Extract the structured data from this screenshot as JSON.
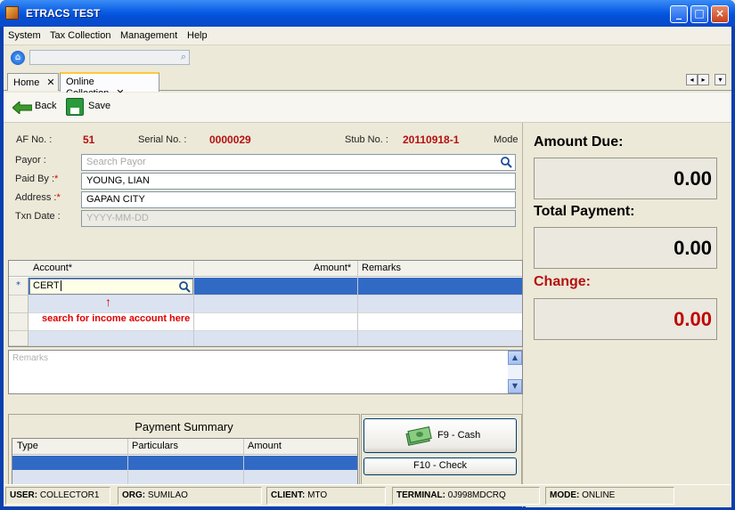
{
  "window": {
    "title": "ETRACS TEST"
  },
  "menu": {
    "items": [
      "System",
      "Tax Collection",
      "Management",
      "Help"
    ]
  },
  "tabs": [
    {
      "label": "Home"
    },
    {
      "label": "Online Collection"
    }
  ],
  "toolbar": {
    "back_label": "Back",
    "save_label": "Save"
  },
  "header": {
    "af_label": "AF No. :",
    "af_value": "51",
    "serial_label": "Serial No. :",
    "serial_value": "0000029",
    "stub_label": "Stub No. :",
    "stub_value": "20110918-1",
    "mode_label": "Mode"
  },
  "form": {
    "payor_label": "Payor :",
    "payor_placeholder": "Search Payor",
    "paidby_label": "Paid By :",
    "paidby_value": "YOUNG, LIAN",
    "address_label": "Address :",
    "address_value": "GAPAN CITY",
    "txndate_label": "Txn Date :",
    "txndate_placeholder": "YYYY-MM-DD"
  },
  "items_grid": {
    "columns": [
      "Account*",
      "Amount*",
      "Remarks"
    ],
    "new_row_marker": "*",
    "account_input": "CERT",
    "annotation": "search for income account here",
    "annotation_arrow": "↑"
  },
  "remarks": {
    "placeholder": "Remarks"
  },
  "payment_summary": {
    "title": "Payment Summary",
    "columns": [
      "Type",
      "Particulars",
      "Amount"
    ]
  },
  "buttons": {
    "cash": "F9 - Cash",
    "check": "F10 - Check"
  },
  "totals": {
    "amount_due_label": "Amount Due:",
    "amount_due": "0.00",
    "total_payment_label": "Total Payment:",
    "total_payment": "0.00",
    "change_label": "Change:",
    "change": "0.00"
  },
  "status": {
    "user_label": "USER:",
    "user": "COLLECTOR1",
    "org_label": "ORG:",
    "org": "SUMILAO",
    "client_label": "CLIENT:",
    "client": "MTO",
    "terminal_label": "TERMINAL:",
    "terminal": "0J998MDCRQ",
    "mode_label": "MODE:",
    "mode": "ONLINE"
  },
  "colors": {
    "title_bar": "#0a5ce4",
    "selected_row": "#316ac5",
    "accent_red": "#b41010"
  }
}
